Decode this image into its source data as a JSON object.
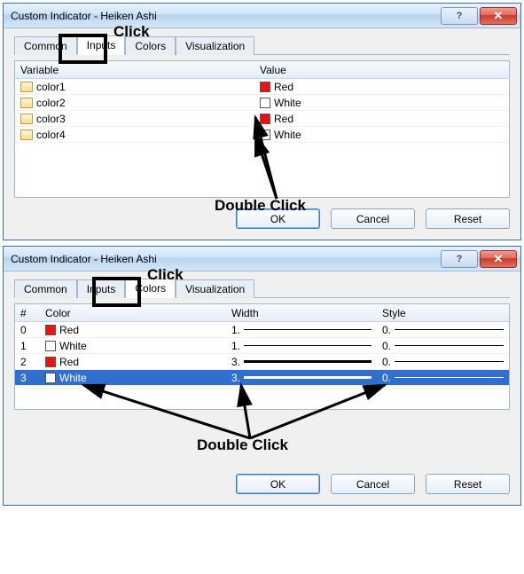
{
  "dialog1": {
    "title": "Custom Indicator - Heiken Ashi",
    "tabs": {
      "common": "Common",
      "inputs": "Inputs",
      "colors": "Colors",
      "visualization": "Visualization"
    },
    "annotation_click": "Click",
    "annotation_dblclick": "Double Click",
    "headers": {
      "variable": "Variable",
      "value": "Value"
    },
    "rows": [
      {
        "var": "color1",
        "value": "Red",
        "swatch": "#e11"
      },
      {
        "var": "color2",
        "value": "White",
        "swatch": "#fff"
      },
      {
        "var": "color3",
        "value": "Red",
        "swatch": "#e11"
      },
      {
        "var": "color4",
        "value": "White",
        "swatch": "#fff"
      }
    ],
    "buttons": {
      "ok": "OK",
      "cancel": "Cancel",
      "reset": "Reset"
    }
  },
  "dialog2": {
    "title": "Custom Indicator - Heiken Ashi",
    "tabs": {
      "common": "Common",
      "inputs": "Inputs",
      "colors": "Colors",
      "visualization": "Visualization"
    },
    "annotation_click": "Click",
    "annotation_dblclick": "Double Click",
    "headers": {
      "idx": "#",
      "color": "Color",
      "width": "Width",
      "style": "Style"
    },
    "rows": [
      {
        "idx": "0",
        "color": "Red",
        "swatch": "#e11",
        "width": "1.",
        "wclass": "w1",
        "style": "0."
      },
      {
        "idx": "1",
        "color": "White",
        "swatch": "#fff",
        "width": "1.",
        "wclass": "w1",
        "style": "0."
      },
      {
        "idx": "2",
        "color": "Red",
        "swatch": "#e11",
        "width": "3.",
        "wclass": "w3",
        "style": "0."
      },
      {
        "idx": "3",
        "color": "White",
        "swatch": "#fff",
        "width": "3.",
        "wclass": "w3",
        "style": "0.",
        "selected": true
      }
    ],
    "buttons": {
      "ok": "OK",
      "cancel": "Cancel",
      "reset": "Reset"
    }
  }
}
